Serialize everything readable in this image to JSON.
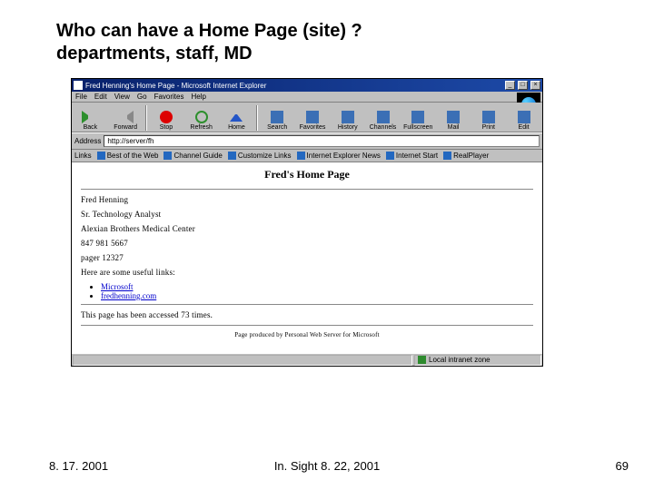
{
  "slide": {
    "title_line1": "Who can have a Home Page (site) ?",
    "title_line2": "departments, staff, MD"
  },
  "browser": {
    "window_title": "Fred Henning's Home Page - Microsoft Internet Explorer",
    "win_buttons": {
      "min": "_",
      "max": "□",
      "close": "×"
    },
    "menu": [
      "File",
      "Edit",
      "View",
      "Go",
      "Favorites",
      "Help"
    ],
    "toolbar": {
      "back": "Back",
      "forward": "Forward",
      "stop": "Stop",
      "refresh": "Refresh",
      "home": "Home",
      "search": "Search",
      "favorites": "Favorites",
      "history": "History",
      "channels": "Channels",
      "fullscreen": "Fullscreen",
      "mail": "Mail",
      "print": "Print",
      "edit": "Edit"
    },
    "address_label": "Address",
    "address_value": "http://server/fh",
    "links_label": "Links",
    "links": [
      "Best of the Web",
      "Channel Guide",
      "Customize Links",
      "Internet Explorer News",
      "Internet Start",
      "RealPlayer"
    ],
    "status_text": "Local intranet zone"
  },
  "page": {
    "heading": "Fred's Home Page",
    "lines": [
      "Fred Henning",
      "Sr. Technology Analyst",
      "Alexian Brothers Medical Center",
      "847 981 5667",
      "pager 12327",
      "Here are some useful links:"
    ],
    "link_items": [
      "Microsoft",
      "fredhenning.com"
    ],
    "hits_line": "This page has been accessed 73 times.",
    "footer_note": "Page produced by Personal Web Server for Microsoft"
  },
  "footer": {
    "left": "8. 17. 2001",
    "center": "In. Sight 8. 22, 2001",
    "right": "69"
  }
}
